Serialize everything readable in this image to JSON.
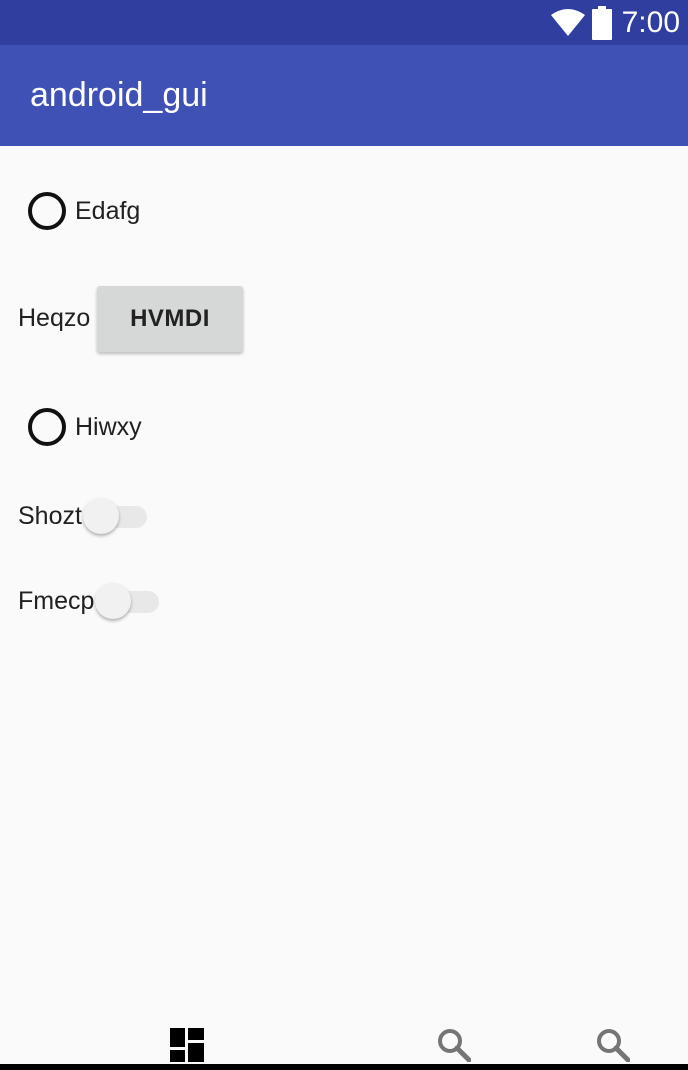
{
  "status_bar": {
    "time": "7:00",
    "icons": [
      "wifi-icon",
      "battery-icon"
    ],
    "background": "#303f9f"
  },
  "app_bar": {
    "title": "android_gui",
    "background": "#3f51b5"
  },
  "content": {
    "radio_1": {
      "label": "Edafg",
      "checked": false
    },
    "label_heqzo": "Heqzo",
    "button_hvmdi": "HVMDI",
    "radio_2": {
      "label": "Hiwxy",
      "checked": false
    },
    "switch_1": {
      "label": "Shozt",
      "on": false
    },
    "switch_2": {
      "label": "Fmecp",
      "on": false
    }
  },
  "bottom_nav": {
    "items": [
      {
        "icon": "dashboard-icon"
      },
      {
        "icon": "search-icon"
      },
      {
        "icon": "search-icon"
      }
    ]
  }
}
